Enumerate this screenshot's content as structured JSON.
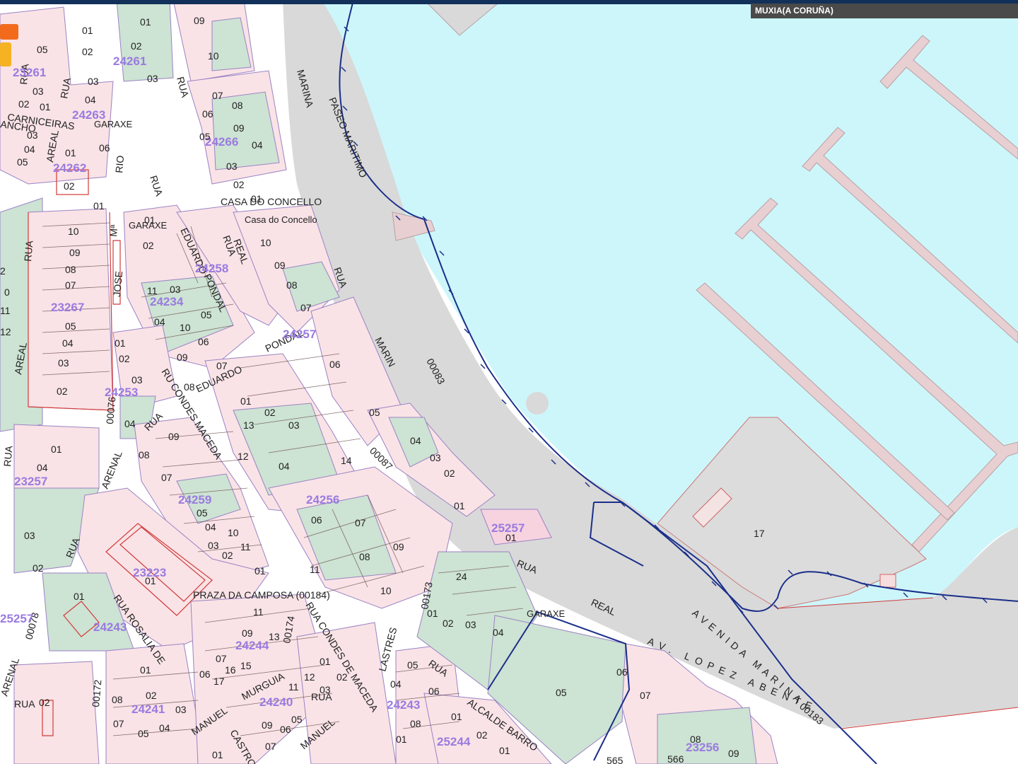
{
  "header": {
    "location": "MUXIA(A CORUÑA)"
  },
  "colors": {
    "sea": "#cdf6fa",
    "road": "#d9d9d9",
    "parcel": "#f9e3e6",
    "garden": "#cde3d3",
    "parcel_stroke": "#9b82c4",
    "parcel_id_color": "#9a7be0",
    "boundary": "#1b2f8a",
    "pier": "#e8cfd1"
  },
  "street_labels": [
    "MARINA",
    "PASEO MARITIMO",
    "RUA",
    "MARIN",
    "RUA",
    "REAL",
    "RUA",
    "PONDAL",
    "EDUARDO",
    "PONDAL",
    "EDUARDO",
    "RUA",
    "JOSE",
    "Mª",
    "RUA",
    "RIO",
    "RUA",
    "RUA",
    "AREAL",
    "AREAL",
    "ARENAL",
    "RUA",
    "RU CONDES MACEDA",
    "RUA",
    "ARENAL",
    "RUA",
    "RUA ROSALIA DE",
    "PRAZA DA CAMPOSA (00184)",
    "RUA CONDES DE MACEDA",
    "MURGUIA",
    "MANUEL",
    "MANUEL",
    "CASTRO",
    "LASTRES",
    "RUA",
    "ALCALDE BARRO",
    "AV. LOPEZ ABENTE",
    "AVENIDA MARINA",
    "RUA",
    "REAL",
    "CARNICEIRAS",
    "ANCHO",
    "RUA",
    "RUA"
  ],
  "place_labels": [
    "CASA DO CONCELLO",
    "Casa do Concello",
    "GARAXE",
    "GARAXE",
    "GARAXE"
  ],
  "road_codes": [
    "00083",
    "00087",
    "00076",
    "00078",
    "00172",
    "00173",
    "00174",
    "00183"
  ],
  "block_ids": [
    "24261",
    "23261",
    "24263",
    "24262",
    "24266",
    "23267",
    "24234",
    "24258",
    "25257",
    "24257",
    "24253",
    "23257",
    "24259",
    "24256",
    "23223",
    "24243",
    "24244",
    "24241",
    "24240",
    "24243",
    "25244",
    "23256",
    "25257"
  ],
  "parcel_numbers": [
    "01",
    "02",
    "03",
    "04",
    "05",
    "06",
    "07",
    "08",
    "09",
    "10",
    "11",
    "12",
    "13",
    "14",
    "15",
    "16",
    "17",
    "24",
    "565",
    "566",
    "0",
    "2",
    "11",
    "12"
  ]
}
